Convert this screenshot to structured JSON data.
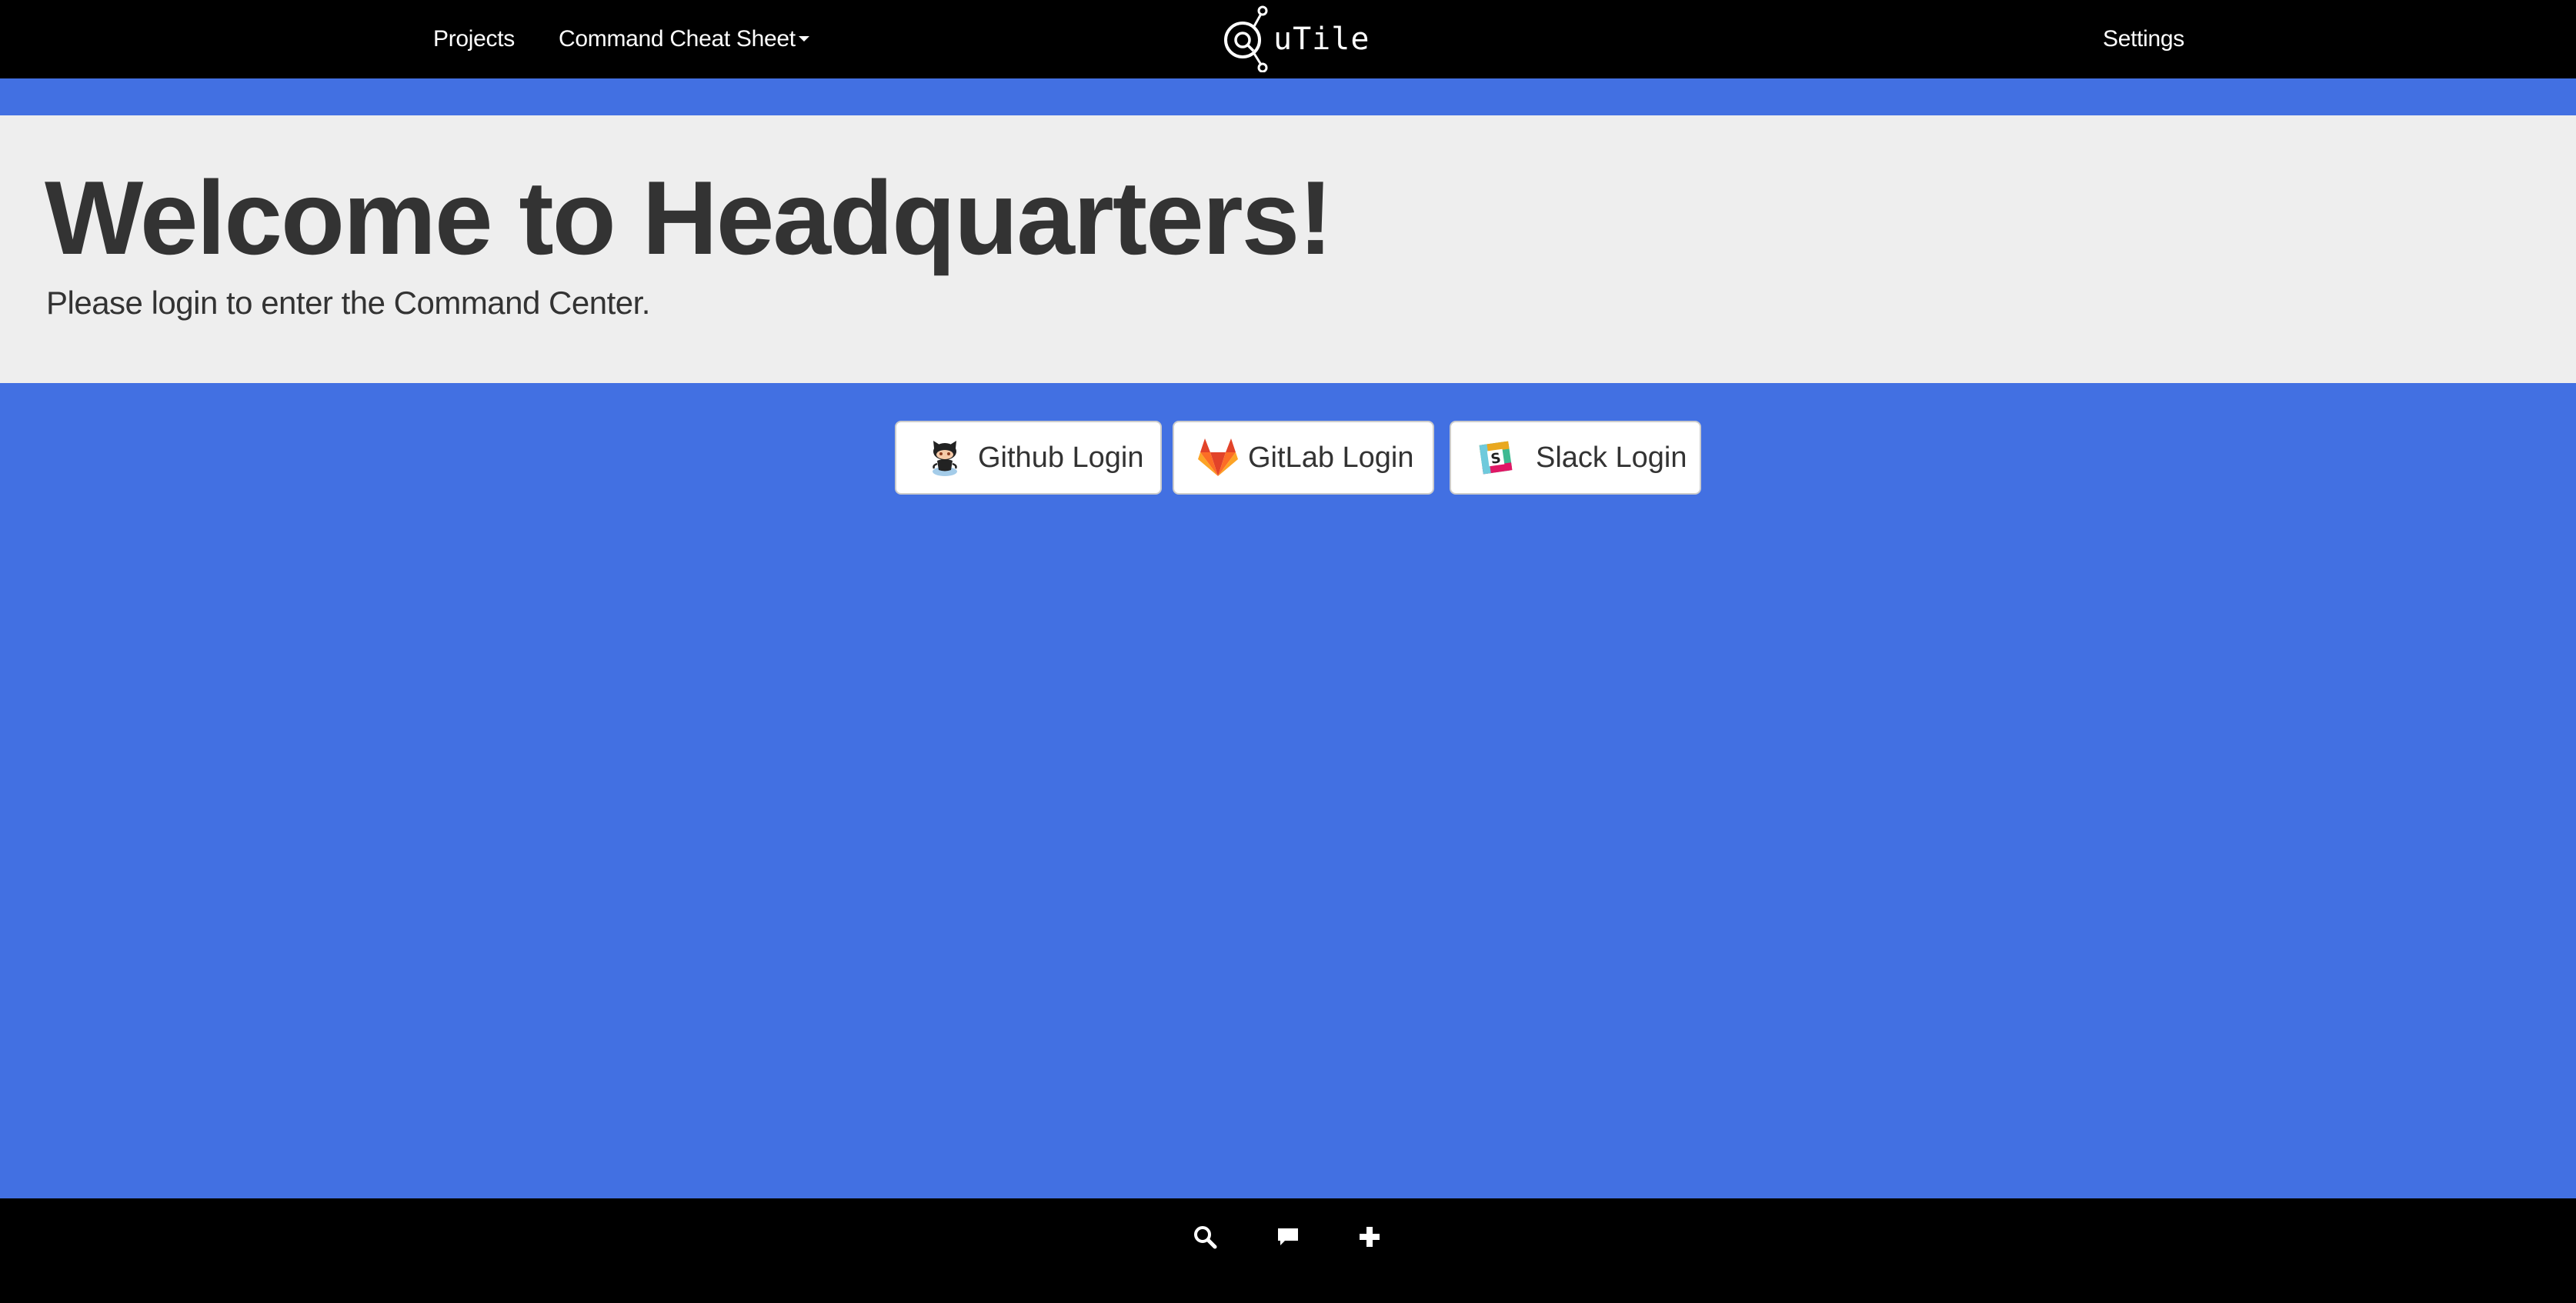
{
  "navbar": {
    "projects_label": "Projects",
    "cheat_sheet_label": "Command Cheat Sheet",
    "settings_label": "Settings",
    "logo_text": "uTile",
    "logo_icon": "qutile-logo-icon"
  },
  "jumbotron": {
    "title": "Welcome to Headquarters!",
    "subtitle": "Please login to enter the Command Center."
  },
  "login": {
    "github_label": "Github Login",
    "gitlab_label": "GitLab Login",
    "slack_label": "Slack Login"
  },
  "footer": {
    "icons": [
      "search-icon",
      "chat-icon",
      "plus-icon"
    ]
  },
  "colors": {
    "background": "#4270e2",
    "navbar": "#000000",
    "jumbotron": "#eeeeee",
    "text": "#333333"
  }
}
